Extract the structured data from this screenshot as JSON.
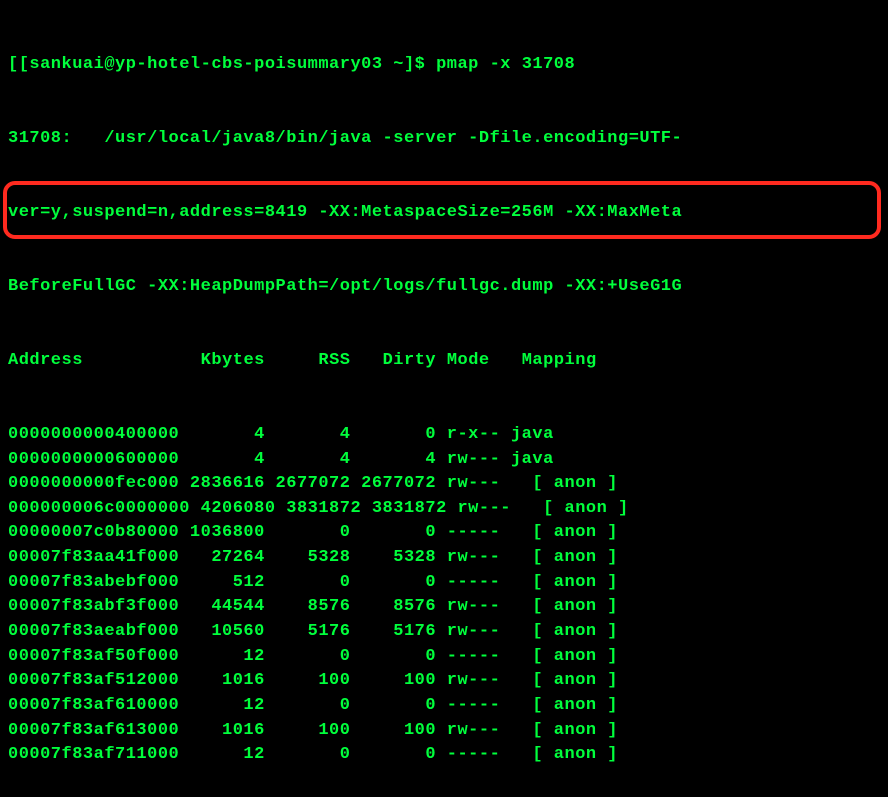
{
  "prompt": "[[sankuai@yp-hotel-cbs-poisummary03 ~]$ ",
  "command": "pmap -x 31708",
  "proc_line1": "31708:   /usr/local/java8/bin/java -server -Dfile.encoding=UTF-",
  "proc_line2": "ver=y,suspend=n,address=8419 -XX:MetaspaceSize=256M -XX:MaxMeta",
  "proc_line3": "BeforeFullGC -XX:HeapDumpPath=/opt/logs/fullgc.dump -XX:+UseG1G",
  "header": {
    "address": "Address",
    "kbytes": "Kbytes",
    "rss": "RSS",
    "dirty": "Dirty",
    "mode": "Mode",
    "mapping": "Mapping"
  },
  "rows": [
    {
      "address": "0000000000400000",
      "kbytes": "4",
      "rss": "4",
      "dirty": "0",
      "mode": "r-x--",
      "mapping": "java"
    },
    {
      "address": "0000000000600000",
      "kbytes": "4",
      "rss": "4",
      "dirty": "4",
      "mode": "rw---",
      "mapping": "java"
    },
    {
      "address": "0000000000fec000",
      "kbytes": "2836616",
      "rss": "2677072",
      "dirty": "2677072",
      "mode": "rw---",
      "mapping": "  [ anon ]"
    },
    {
      "address": "000000006c0000000",
      "kbytes": "4206080",
      "rss": "3831872",
      "dirty": "3831872",
      "mode": "rw---",
      "mapping": "  [ anon ]"
    },
    {
      "address": "00000007c0b80000",
      "kbytes": "1036800",
      "rss": "0",
      "dirty": "0",
      "mode": "-----",
      "mapping": "  [ anon ]"
    },
    {
      "address": "00007f83aa41f000",
      "kbytes": "27264",
      "rss": "5328",
      "dirty": "5328",
      "mode": "rw---",
      "mapping": "  [ anon ]"
    },
    {
      "address": "00007f83abebf000",
      "kbytes": "512",
      "rss": "0",
      "dirty": "0",
      "mode": "-----",
      "mapping": "  [ anon ]"
    },
    {
      "address": "00007f83abf3f000",
      "kbytes": "44544",
      "rss": "8576",
      "dirty": "8576",
      "mode": "rw---",
      "mapping": "  [ anon ]"
    },
    {
      "address": "00007f83aeabf000",
      "kbytes": "10560",
      "rss": "5176",
      "dirty": "5176",
      "mode": "rw---",
      "mapping": "  [ anon ]"
    },
    {
      "address": "00007f83af50f000",
      "kbytes": "12",
      "rss": "0",
      "dirty": "0",
      "mode": "-----",
      "mapping": "  [ anon ]"
    },
    {
      "address": "00007f83af512000",
      "kbytes": "1016",
      "rss": "100",
      "dirty": "100",
      "mode": "rw---",
      "mapping": "  [ anon ]"
    },
    {
      "address": "00007f83af610000",
      "kbytes": "12",
      "rss": "0",
      "dirty": "0",
      "mode": "-----",
      "mapping": "  [ anon ]"
    },
    {
      "address": "00007f83af613000",
      "kbytes": "1016",
      "rss": "100",
      "dirty": "100",
      "mode": "rw---",
      "mapping": "  [ anon ]"
    },
    {
      "address": "00007f83af711000",
      "kbytes": "12",
      "rss": "0",
      "dirty": "0",
      "mode": "-----",
      "mapping": "  [ anon ]"
    }
  ]
}
